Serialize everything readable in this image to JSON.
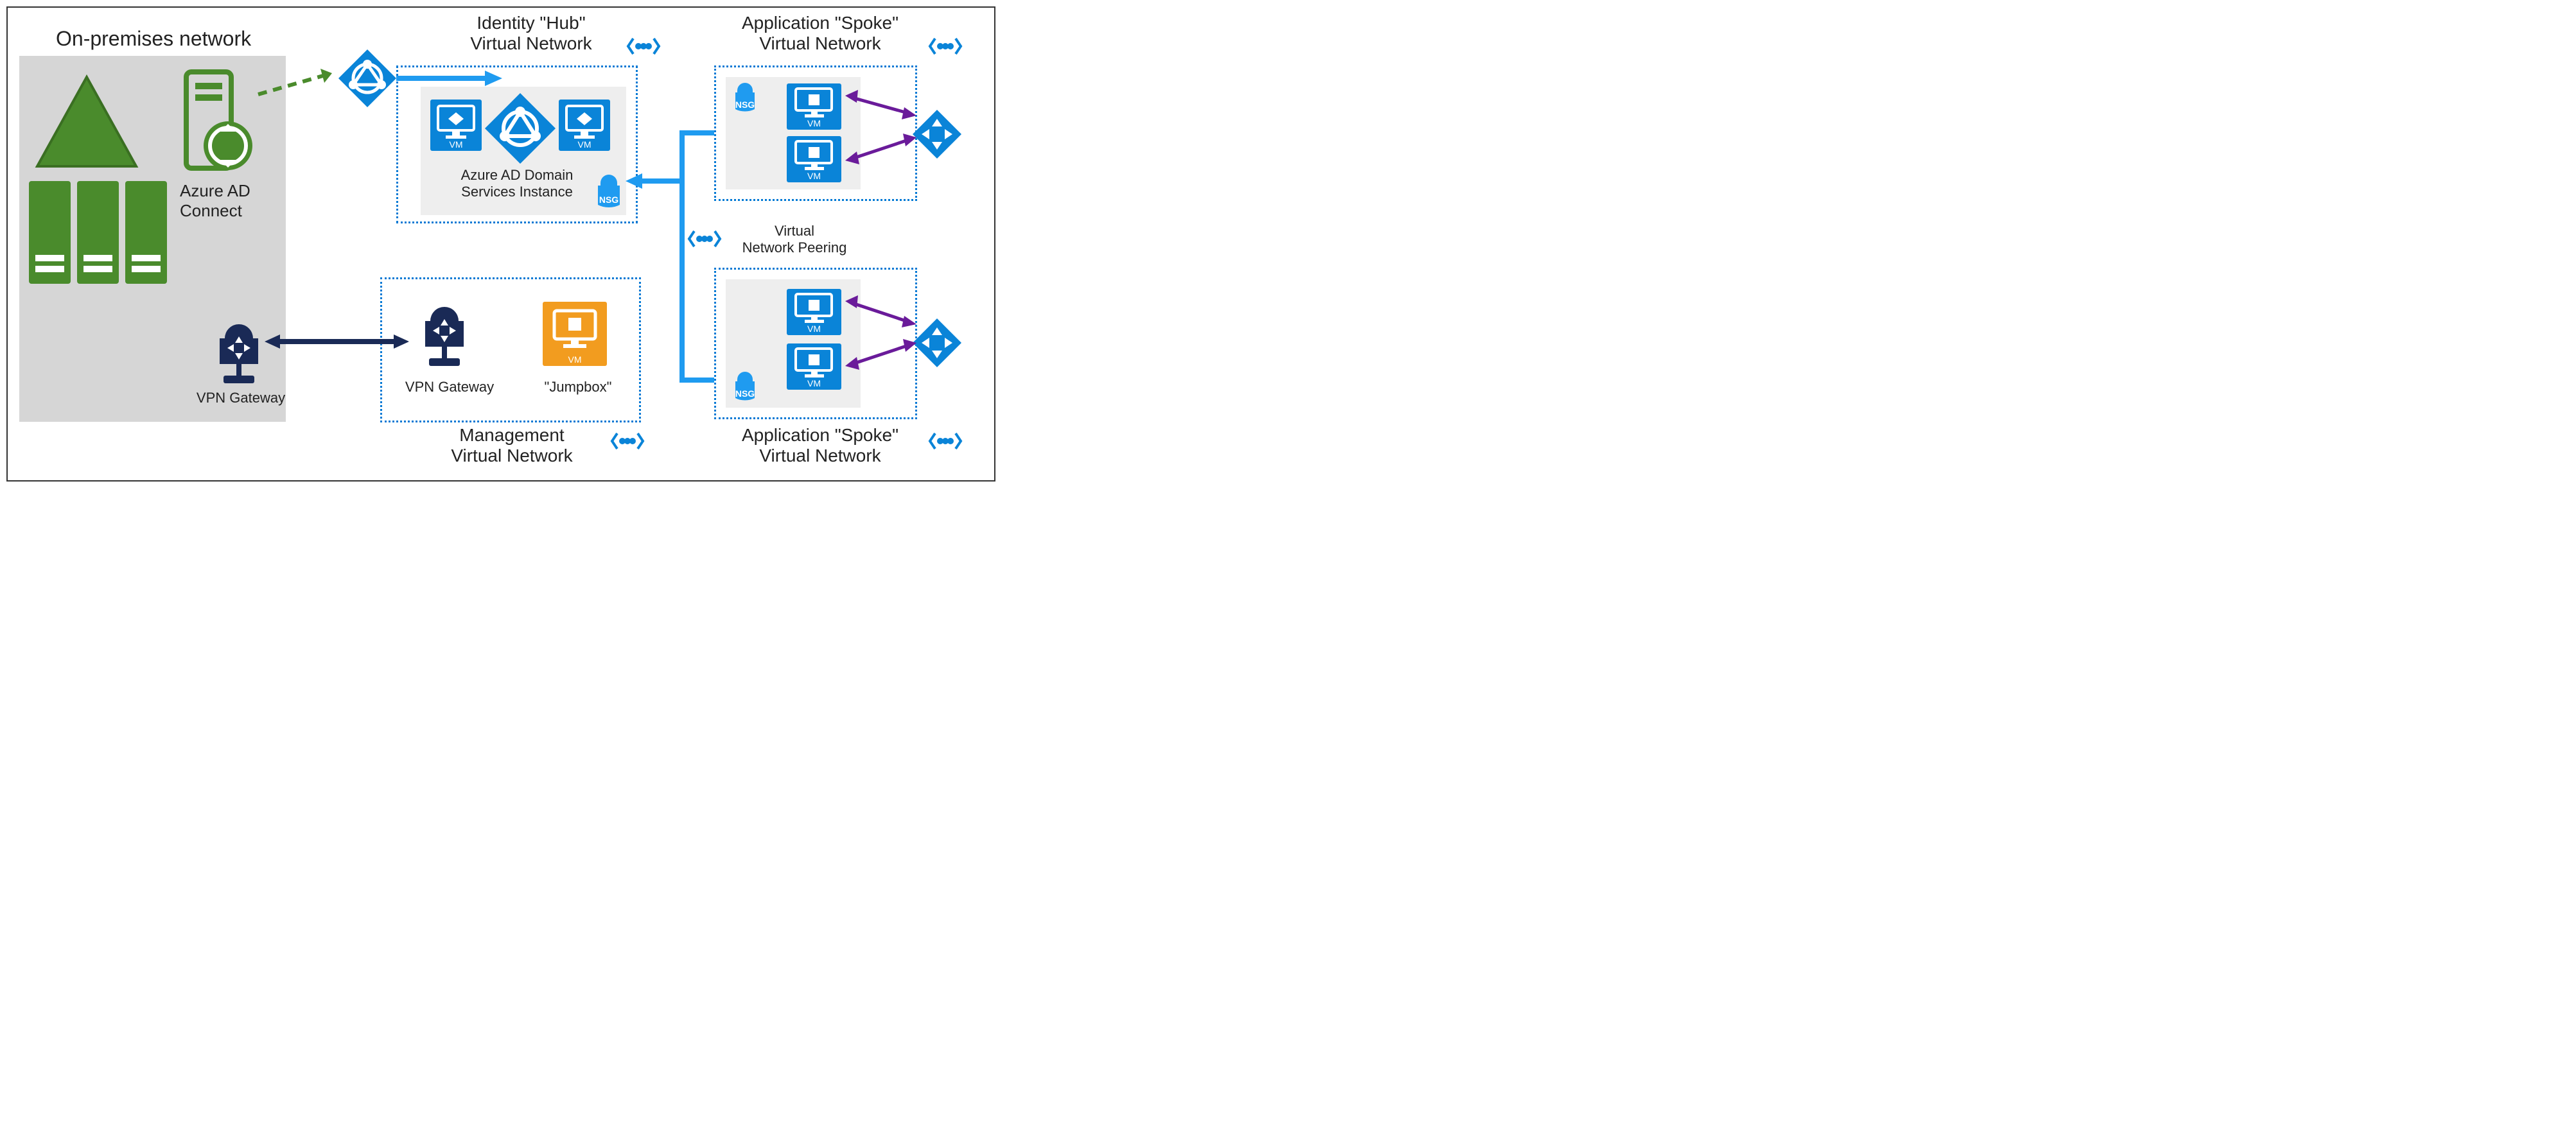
{
  "titles": {
    "onprem": "On-premises network",
    "identity_hub_line1": "Identity \"Hub\"",
    "identity_hub_line2": "Virtual Network",
    "app_spoke_line1": "Application \"Spoke\"",
    "app_spoke_line2": "Virtual Network",
    "management_line1": "Management",
    "management_line2": "Virtual Network",
    "peering_line1": "Virtual",
    "peering_line2": "Network Peering"
  },
  "labels": {
    "azure_ad_connect_line1": "Azure AD",
    "azure_ad_connect_line2": "Connect",
    "vpn_gateway_onprem": "VPN Gateway",
    "vpn_gateway_mgmt": "VPN Gateway",
    "jumpbox": "\"Jumpbox\"",
    "aaddns_line1": "Azure AD Domain",
    "aaddns_line2": "Services Instance",
    "nsg": "NSG",
    "vm": "VM"
  },
  "icons": {
    "triangle": "on-prem-triangle-icon",
    "server_rack": "server-rack-icon",
    "sync_server": "sync-server-icon",
    "aad": "azure-ad-icon",
    "vm": "vm-monitor-icon",
    "nsg": "nsg-lock-icon",
    "vpn": "vpn-gateway-icon",
    "lb": "load-balancer-icon",
    "peering": "peering-icon"
  },
  "colors": {
    "azure_blue": "#0a84d8",
    "bright_blue": "#1f9bf0",
    "dark_navy": "#1a2a56",
    "green": "#4a8b2c",
    "orange": "#f29c1f",
    "purple": "#6a1b9a"
  },
  "diagram": {
    "networks": [
      {
        "name": "on_premises",
        "type": "on-prem",
        "title_key": "titles.onprem"
      },
      {
        "name": "identity_hub",
        "type": "vnet",
        "title_key": "titles.identity_hub_line1"
      },
      {
        "name": "management",
        "type": "vnet",
        "title_key": "titles.management_line1"
      },
      {
        "name": "app_spoke_1",
        "type": "vnet",
        "title_key": "titles.app_spoke_line1"
      },
      {
        "name": "app_spoke_2",
        "type": "vnet",
        "title_key": "titles.app_spoke_line1"
      }
    ],
    "connections": [
      {
        "from": "on_premises.sync_server",
        "to": "azure_ad_cloud",
        "style": "dashed-green-arrow"
      },
      {
        "from": "azure_ad_cloud",
        "to": "identity_hub.aadds",
        "style": "solid-blue-arrow"
      },
      {
        "from": "app_spoke_1",
        "to": "identity_hub.aadds",
        "style": "solid-blue-arrow",
        "via": "peering"
      },
      {
        "from": "app_spoke_2",
        "to": "identity_hub.aadds",
        "style": "solid-blue-arrow",
        "via": "peering"
      },
      {
        "from": "on_premises.vpn_gateway",
        "to": "management.vpn_gateway",
        "style": "solid-navy-double-arrow"
      },
      {
        "from": "app_spoke_1.load_balancer",
        "to": "app_spoke_1.vm1",
        "style": "purple-double-arrow"
      },
      {
        "from": "app_spoke_1.load_balancer",
        "to": "app_spoke_1.vm2",
        "style": "purple-double-arrow"
      },
      {
        "from": "app_spoke_2.load_balancer",
        "to": "app_spoke_2.vm1",
        "style": "purple-double-arrow"
      },
      {
        "from": "app_spoke_2.load_balancer",
        "to": "app_spoke_2.vm2",
        "style": "purple-double-arrow"
      }
    ]
  }
}
